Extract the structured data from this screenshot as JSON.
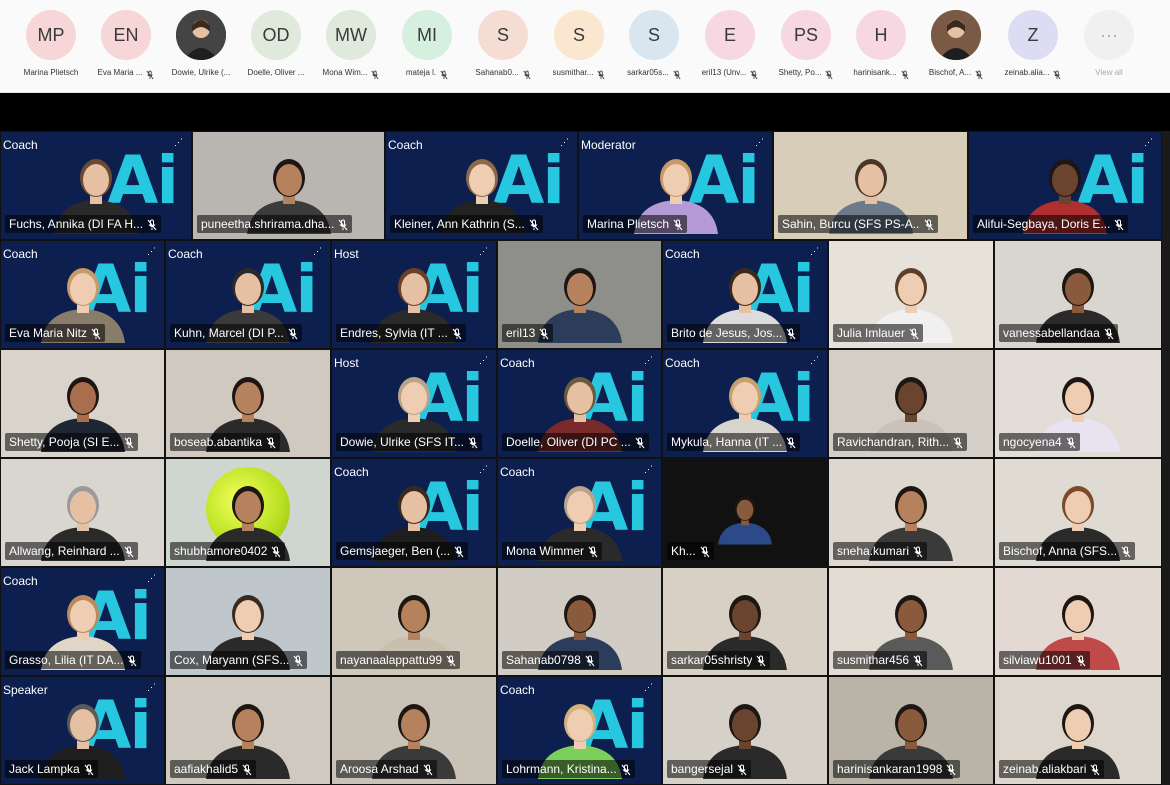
{
  "participants_bar": {
    "items": [
      {
        "initials": "MP",
        "name": "Marina Plietsch",
        "bg": "#f6d6d6",
        "muted": false
      },
      {
        "initials": "EN",
        "name": "Eva Maria ...",
        "bg": "#f6d6d6",
        "muted": true
      },
      {
        "initials": "",
        "name": "Dowie, Ulrike (...",
        "bg": "#444444",
        "muted": false,
        "photo": true
      },
      {
        "initials": "OD",
        "name": "Doelle, Oliver ...",
        "bg": "#dfe9dc",
        "muted": false
      },
      {
        "initials": "MW",
        "name": "Mona Wim...",
        "bg": "#dfe9dc",
        "muted": true
      },
      {
        "initials": "MI",
        "name": "mateja l.",
        "bg": "#d6f0e0",
        "muted": true
      },
      {
        "initials": "S",
        "name": "Sahanab0...",
        "bg": "#f6ddd4",
        "muted": true
      },
      {
        "initials": "S",
        "name": "susmithar...",
        "bg": "#fbe6cf",
        "muted": true
      },
      {
        "initials": "S",
        "name": "sarkar05s...",
        "bg": "#d9e6ef",
        "muted": true
      },
      {
        "initials": "E",
        "name": "eril13 (Unv...",
        "bg": "#f7d8e2",
        "muted": true
      },
      {
        "initials": "PS",
        "name": "Shetty, Po...",
        "bg": "#f7d8e2",
        "muted": true
      },
      {
        "initials": "H",
        "name": "harinisank...",
        "bg": "#f7d8e2",
        "muted": true
      },
      {
        "initials": "",
        "name": "Bischof, A...",
        "bg": "#7a5a45",
        "muted": true,
        "photo": true
      },
      {
        "initials": "Z",
        "name": "zeinab.alia...",
        "bg": "#dcdcf3",
        "muted": true
      },
      {
        "initials": "···",
        "name": "View all",
        "bg": "#f0f0f0",
        "muted": false,
        "viewall": true
      }
    ]
  },
  "gallery": {
    "tiles": [
      {
        "name": "Fuchs, Annika (DI FA H...",
        "role": "Coach",
        "ai": true,
        "bg": "#0d1f4f",
        "skin": "#e6c0a2",
        "hair": "#6b4a32",
        "shirt": "#2a2a2a"
      },
      {
        "name": "puneetha.shrirama.dha...",
        "role": "",
        "ai": false,
        "bg": "#b9b6b2",
        "skin": "#b6815d",
        "hair": "#1e1612",
        "shirt": "#3b3b3b"
      },
      {
        "name": "Kleiner, Ann Kathrin (S...",
        "role": "Coach",
        "ai": true,
        "bg": "#0d1f4f",
        "skin": "#efcdb3",
        "hair": "#8b6a45",
        "shirt": "#222222"
      },
      {
        "name": "Marina Plietsch",
        "role": "Moderator",
        "ai": true,
        "bg": "#0d1f4f",
        "skin": "#efcdb3",
        "hair": "#c79a66",
        "shirt": "#b49ad6"
      },
      {
        "name": "Sahin, Burcu (SFS PS-A...",
        "role": "",
        "ai": false,
        "bg": "#d8cdb9",
        "skin": "#e6c0a2",
        "hair": "#4a3526",
        "shirt": "#6d7a8a"
      },
      {
        "name": "Alifui-Segbaya, Doris E...",
        "role": "",
        "ai": true,
        "bg": "#0d1f4f",
        "skin": "#6b4430",
        "hair": "#1e1612",
        "shirt": "#b03030"
      },
      {
        "name": "Eva Maria Nitz",
        "role": "Coach",
        "ai": true,
        "bg": "#0d1f4f",
        "skin": "#efcdb3",
        "hair": "#c79a66",
        "shirt": "#8a7c6a"
      },
      {
        "name": "Kuhn, Marcel (DI P...",
        "role": "Coach",
        "ai": true,
        "bg": "#0d1f4f",
        "skin": "#e6c0a2",
        "hair": "#2a2a2a",
        "shirt": "#3a3a3a"
      },
      {
        "name": "Endres, Sylvia (IT ...",
        "role": "Host",
        "ai": true,
        "bg": "#0d1f4f",
        "skin": "#e6c0a2",
        "hair": "#6b3f26",
        "shirt": "#2a2a2a"
      },
      {
        "name": "eril13",
        "role": "",
        "ai": false,
        "bg": "#8e8e8a",
        "skin": "#b6815d",
        "hair": "#1e1612",
        "shirt": "#2c3d5c"
      },
      {
        "name": "Brito de Jesus, Jos...",
        "role": "Coach",
        "ai": true,
        "bg": "#0d1f4f",
        "skin": "#e6c0a2",
        "hair": "#3a2a1e",
        "shirt": "#dcdcdc"
      },
      {
        "name": "Julia Imlauer",
        "role": "",
        "ai": false,
        "bg": "#e6e2da",
        "skin": "#efcdb3",
        "hair": "#5a3f2a",
        "shirt": "#f0f0f0"
      },
      {
        "name": "vanessabellandaa",
        "role": "",
        "ai": false,
        "bg": "#d9d6d0",
        "skin": "#8a5a3c",
        "hair": "#1e1612",
        "shirt": "#2a2a2a"
      },
      {
        "name": "Shetty, Pooja (SI E...",
        "role": "",
        "ai": false,
        "bg": "#d8d3cb",
        "skin": "#a86e4e",
        "hair": "#1e1612",
        "shirt": "#1f2633"
      },
      {
        "name": "boseab.abantika",
        "role": "",
        "ai": false,
        "bg": "#cfc9bf",
        "skin": "#b6815d",
        "hair": "#1e1612",
        "shirt": "#2a2a2a"
      },
      {
        "name": "Dowie, Ulrike (SFS IT...",
        "role": "Host",
        "ai": true,
        "bg": "#0d1f4f",
        "skin": "#efcdb3",
        "hair": "#b9a48a",
        "shirt": "#2a2a2a"
      },
      {
        "name": "Doelle, Oliver (DI PC ...",
        "role": "Coach",
        "ai": true,
        "bg": "#0d1f4f",
        "skin": "#e6c0a2",
        "hair": "#6b5a3f",
        "shirt": "#7a2a2a"
      },
      {
        "name": "Mykula, Hanna (IT ...",
        "role": "Coach",
        "ai": true,
        "bg": "#0d1f4f",
        "skin": "#efcdb3",
        "hair": "#c7a070",
        "shirt": "#d8d4ce"
      },
      {
        "name": "Ravichandran, Rith...",
        "role": "",
        "ai": false,
        "bg": "#d4cfc6",
        "skin": "#6b4430",
        "hair": "#1e1612",
        "shirt": "#c8c2b8"
      },
      {
        "name": "ngocyena4",
        "role": "",
        "ai": false,
        "bg": "#e2ddd6",
        "skin": "#efcdb3",
        "hair": "#1e1612",
        "shirt": "#e9e2f0"
      },
      {
        "name": "Allwang, Reinhard ...",
        "role": "",
        "ai": false,
        "bg": "#d9d6d0",
        "skin": "#e6c0a2",
        "hair": "#9a9a9a",
        "shirt": "#2a2a2a"
      },
      {
        "name": "shubhamore0402",
        "role": "",
        "ai": false,
        "bg": "#cfd6cf",
        "skin": "#b6815d",
        "hair": "#1e1612",
        "shirt": "#2a2a2a",
        "ball": true
      },
      {
        "name": "Gemsjaeger, Ben (...",
        "role": "Coach",
        "ai": true,
        "bg": "#0d1f4f",
        "skin": "#e6c0a2",
        "hair": "#3a2a1e",
        "shirt": "#1e1e1e"
      },
      {
        "name": "Mona Wimmer",
        "role": "Coach",
        "ai": true,
        "bg": "#0d1f4f",
        "skin": "#efcdb3",
        "hair": "#b9a48a",
        "shirt": "#2a2a2a"
      },
      {
        "name": "Kh...",
        "role": "",
        "ai": false,
        "bg": "#111111",
        "skin": "#8a5a3c",
        "hair": "#1e1612",
        "shirt": "#2c4a8a",
        "narrow": true
      },
      {
        "name": "sneha.kumari",
        "role": "",
        "ai": false,
        "bg": "#dcd8d0",
        "skin": "#b6815d",
        "hair": "#1e1612",
        "shirt": "#3a3a3a"
      },
      {
        "name": "Bischof, Anna (SFS...",
        "role": "",
        "ai": false,
        "bg": "#dfdbd3",
        "skin": "#efcdb3",
        "hair": "#7a4a2a",
        "shirt": "#2a2a2a"
      },
      {
        "name": "Grasso, Lilia (IT DA...",
        "role": "Coach",
        "ai": true,
        "bg": "#0d1f4f",
        "skin": "#efcdb3",
        "hair": "#b98a5a",
        "shirt": "#e0d6c8"
      },
      {
        "name": "Cox, Maryann (SFS...",
        "role": "",
        "ai": false,
        "bg": "#bfc7cc",
        "skin": "#efcdb3",
        "hair": "#3a2a1e",
        "shirt": "#2a2a2a"
      },
      {
        "name": "nayanaalappattu99",
        "role": "",
        "ai": false,
        "bg": "#cfc7ba",
        "skin": "#b6815d",
        "hair": "#1e1612",
        "shirt": "#c8bfae"
      },
      {
        "name": "Sahanab0798",
        "role": "",
        "ai": false,
        "bg": "#d2cdc4",
        "skin": "#8a5a3c",
        "hair": "#1e1612",
        "shirt": "#2c3d5c"
      },
      {
        "name": "sarkar05shristy",
        "role": "",
        "ai": false,
        "bg": "#d8d0c4",
        "skin": "#6b4430",
        "hair": "#1e1612",
        "shirt": "#2a2a2a"
      },
      {
        "name": "susmithar456",
        "role": "",
        "ai": false,
        "bg": "#e2dcd2",
        "skin": "#8a5a3c",
        "hair": "#1e1612",
        "shirt": "#5a5a5a"
      },
      {
        "name": "silviawu1001",
        "role": "",
        "ai": false,
        "bg": "#e4d9d2",
        "skin": "#efcdb3",
        "hair": "#1e1612",
        "shirt": "#c04a4a"
      },
      {
        "name": "Jack Lampka",
        "role": "Speaker",
        "ai": true,
        "bg": "#0d1f4f",
        "skin": "#e6c0a2",
        "hair": "#5a5a5a",
        "shirt": "#1e1e1e"
      },
      {
        "name": "aafiakhalid5",
        "role": "",
        "ai": false,
        "bg": "#cfc9bf",
        "skin": "#b6815d",
        "hair": "#1e1612",
        "shirt": "#2a2a2a"
      },
      {
        "name": "Aroosa Arshad",
        "role": "",
        "ai": false,
        "bg": "#c9c2b6",
        "skin": "#b6815d",
        "hair": "#1e1612",
        "shirt": "#3a3a3a"
      },
      {
        "name": "Lohrmann, Kristina...",
        "role": "Coach",
        "ai": true,
        "bg": "#0d1f4f",
        "skin": "#efcdb3",
        "hair": "#d4b07a",
        "shirt": "#7ccf5a"
      },
      {
        "name": "bangersejal",
        "role": "",
        "ai": false,
        "bg": "#d6d1c8",
        "skin": "#6b4430",
        "hair": "#1e1612",
        "shirt": "#2a2a2a"
      },
      {
        "name": "harinisankaran1998",
        "role": "",
        "ai": false,
        "bg": "#b9b3a8",
        "skin": "#8a5a3c",
        "hair": "#1e1612",
        "shirt": "#3a3a3a"
      },
      {
        "name": "zeinab.aliakbari",
        "role": "",
        "ai": false,
        "bg": "#dcd6cc",
        "skin": "#efcdb3",
        "hair": "#1e1612",
        "shirt": "#2a2a2a"
      }
    ]
  },
  "ai_logo_text": "Ai",
  "ai_logo_color": "#27c7e0",
  "ai_logo_dots": "⋰",
  "icons": {
    "mic_off": "mic-off-icon",
    "more": "more-icon"
  }
}
